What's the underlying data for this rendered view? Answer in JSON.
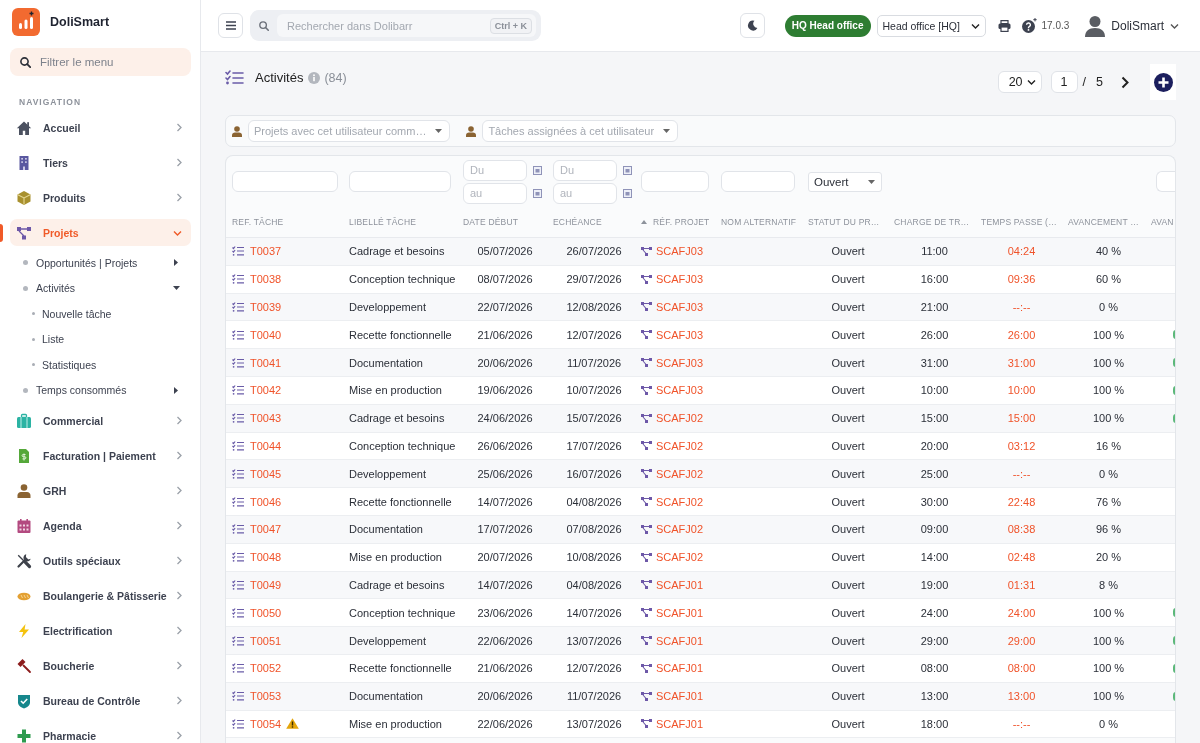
{
  "app": {
    "name": "DoliSmart"
  },
  "sidebar": {
    "filter": {
      "placeholder": "Filtrer le menu"
    },
    "section_title": "NAVIGATION",
    "items": [
      {
        "label": "Accueil",
        "selected": false,
        "expanded": false
      },
      {
        "label": "Tiers",
        "selected": false,
        "expanded": false
      },
      {
        "label": "Produits",
        "selected": false,
        "expanded": false
      },
      {
        "label": "Projets",
        "selected": true,
        "expanded": true,
        "children": [
          {
            "label": "Opportunités | Projets",
            "expanded": false
          },
          {
            "label": "Activités",
            "expanded": true,
            "children": [
              {
                "label": "Nouvelle tâche"
              },
              {
                "label": "Liste"
              },
              {
                "label": "Statistiques"
              }
            ]
          },
          {
            "label": "Temps consommés",
            "expanded": false
          }
        ]
      },
      {
        "label": "Commercial",
        "selected": false,
        "expanded": false
      },
      {
        "label": "Facturation | Paiement",
        "selected": false,
        "expanded": false
      },
      {
        "label": "GRH",
        "selected": false,
        "expanded": false
      },
      {
        "label": "Agenda",
        "selected": false,
        "expanded": false
      },
      {
        "label": "Outils spéciaux",
        "selected": false,
        "expanded": false
      },
      {
        "label": "Boulangerie & Pâtisserie",
        "selected": false,
        "expanded": false
      },
      {
        "label": "Electrification",
        "selected": false,
        "expanded": false
      },
      {
        "label": "Boucherie",
        "selected": false,
        "expanded": false
      },
      {
        "label": "Bureau de Contrôle",
        "selected": false,
        "expanded": false
      },
      {
        "label": "Pharmacie",
        "selected": false,
        "expanded": false
      }
    ]
  },
  "topbar": {
    "search": {
      "placeholder": "Rechercher dans Dolibarr",
      "shortcut": "Ctrl + K"
    },
    "entity_badge": "HQ Head office",
    "entity_select": "Head office [HQ]",
    "version": "17.0.3",
    "user": "DoliSmart"
  },
  "page": {
    "title": "Activités",
    "count": "(84)",
    "pagination": {
      "per_page": "20",
      "page": "1",
      "separator": "/",
      "total": "5"
    }
  },
  "filters": [
    {
      "placeholder": "Projets avec cet utilisateur comm…"
    },
    {
      "placeholder": "Tâches assignées à cet utilisateur"
    }
  ],
  "table": {
    "columns": [
      {
        "label": "REF. TÂCHE",
        "sorted": false,
        "filter": {
          "kind": "text"
        }
      },
      {
        "label": "LIBELLÉ TÂCHE",
        "sorted": false,
        "filter": {
          "kind": "text"
        }
      },
      {
        "label": "DATE DÉBUT",
        "sorted": false,
        "filter": {
          "kind": "date-range",
          "from": {
            "placeholder": "Du"
          },
          "to": {
            "placeholder": "au"
          }
        }
      },
      {
        "label": "ECHÉANCE",
        "sorted": false,
        "filter": {
          "kind": "date-range",
          "from": {
            "placeholder": "Du"
          },
          "to": {
            "placeholder": "au"
          }
        }
      },
      {
        "label": "RÉF. PROJET",
        "sorted": true,
        "filter": {
          "kind": "text"
        }
      },
      {
        "label": "NOM ALTERNATIF",
        "sorted": false,
        "filter": {
          "kind": "text"
        }
      },
      {
        "label": "STATUT DU PR…",
        "sorted": false,
        "filter": {
          "kind": "select",
          "value": "Ouvert"
        }
      },
      {
        "label": "CHARGE DE TR…",
        "sorted": false
      },
      {
        "label": "TEMPS PASSE (…",
        "sorted": false
      },
      {
        "label": "AVANCEMENT …",
        "sorted": false
      },
      {
        "label": "AVAN",
        "sorted": false,
        "filter": {
          "kind": "text"
        }
      }
    ],
    "rows": [
      {
        "ref": "T0037",
        "warning": false,
        "label": "Cadrage et besoins",
        "start": "05/07/2026",
        "due": "26/07/2026",
        "project": "SCAFJ03",
        "status": "Ouvert",
        "planned": "11:00",
        "spent": "04:24",
        "progress": "40 %",
        "complete": false
      },
      {
        "ref": "T0038",
        "warning": false,
        "label": "Conception technique",
        "start": "08/07/2026",
        "due": "29/07/2026",
        "project": "SCAFJ03",
        "status": "Ouvert",
        "planned": "16:00",
        "spent": "09:36",
        "progress": "60 %",
        "complete": false
      },
      {
        "ref": "T0039",
        "warning": false,
        "label": "Developpement",
        "start": "22/07/2026",
        "due": "12/08/2026",
        "project": "SCAFJ03",
        "status": "Ouvert",
        "planned": "21:00",
        "spent": "--:--",
        "progress": "0 %",
        "complete": false
      },
      {
        "ref": "T0040",
        "warning": false,
        "label": "Recette fonctionnelle",
        "start": "21/06/2026",
        "due": "12/07/2026",
        "project": "SCAFJ03",
        "status": "Ouvert",
        "planned": "26:00",
        "spent": "26:00",
        "progress": "100 %",
        "complete": true
      },
      {
        "ref": "T0041",
        "warning": false,
        "label": "Documentation",
        "start": "20/06/2026",
        "due": "11/07/2026",
        "project": "SCAFJ03",
        "status": "Ouvert",
        "planned": "31:00",
        "spent": "31:00",
        "progress": "100 %",
        "complete": true
      },
      {
        "ref": "T0042",
        "warning": false,
        "label": "Mise en production",
        "start": "19/06/2026",
        "due": "10/07/2026",
        "project": "SCAFJ03",
        "status": "Ouvert",
        "planned": "10:00",
        "spent": "10:00",
        "progress": "100 %",
        "complete": true
      },
      {
        "ref": "T0043",
        "warning": false,
        "label": "Cadrage et besoins",
        "start": "24/06/2026",
        "due": "15/07/2026",
        "project": "SCAFJ02",
        "status": "Ouvert",
        "planned": "15:00",
        "spent": "15:00",
        "progress": "100 %",
        "complete": true
      },
      {
        "ref": "T0044",
        "warning": false,
        "label": "Conception technique",
        "start": "26/06/2026",
        "due": "17/07/2026",
        "project": "SCAFJ02",
        "status": "Ouvert",
        "planned": "20:00",
        "spent": "03:12",
        "progress": "16 %",
        "complete": false
      },
      {
        "ref": "T0045",
        "warning": false,
        "label": "Developpement",
        "start": "25/06/2026",
        "due": "16/07/2026",
        "project": "SCAFJ02",
        "status": "Ouvert",
        "planned": "25:00",
        "spent": "--:--",
        "progress": "0 %",
        "complete": false
      },
      {
        "ref": "T0046",
        "warning": false,
        "label": "Recette fonctionnelle",
        "start": "14/07/2026",
        "due": "04/08/2026",
        "project": "SCAFJ02",
        "status": "Ouvert",
        "planned": "30:00",
        "spent": "22:48",
        "progress": "76 %",
        "complete": false
      },
      {
        "ref": "T0047",
        "warning": false,
        "label": "Documentation",
        "start": "17/07/2026",
        "due": "07/08/2026",
        "project": "SCAFJ02",
        "status": "Ouvert",
        "planned": "09:00",
        "spent": "08:38",
        "progress": "96 %",
        "complete": false
      },
      {
        "ref": "T0048",
        "warning": false,
        "label": "Mise en production",
        "start": "20/07/2026",
        "due": "10/08/2026",
        "project": "SCAFJ02",
        "status": "Ouvert",
        "planned": "14:00",
        "spent": "02:48",
        "progress": "20 %",
        "complete": false
      },
      {
        "ref": "T0049",
        "warning": false,
        "label": "Cadrage et besoins",
        "start": "14/07/2026",
        "due": "04/08/2026",
        "project": "SCAFJ01",
        "status": "Ouvert",
        "planned": "19:00",
        "spent": "01:31",
        "progress": "8 %",
        "complete": false
      },
      {
        "ref": "T0050",
        "warning": false,
        "label": "Conception technique",
        "start": "23/06/2026",
        "due": "14/07/2026",
        "project": "SCAFJ01",
        "status": "Ouvert",
        "planned": "24:00",
        "spent": "24:00",
        "progress": "100 %",
        "complete": true
      },
      {
        "ref": "T0051",
        "warning": false,
        "label": "Developpement",
        "start": "22/06/2026",
        "due": "13/07/2026",
        "project": "SCAFJ01",
        "status": "Ouvert",
        "planned": "29:00",
        "spent": "29:00",
        "progress": "100 %",
        "complete": true
      },
      {
        "ref": "T0052",
        "warning": false,
        "label": "Recette fonctionnelle",
        "start": "21/06/2026",
        "due": "12/07/2026",
        "project": "SCAFJ01",
        "status": "Ouvert",
        "planned": "08:00",
        "spent": "08:00",
        "progress": "100 %",
        "complete": true
      },
      {
        "ref": "T0053",
        "warning": false,
        "label": "Documentation",
        "start": "20/06/2026",
        "due": "11/07/2026",
        "project": "SCAFJ01",
        "status": "Ouvert",
        "planned": "13:00",
        "spent": "13:00",
        "progress": "100 %",
        "complete": true
      },
      {
        "ref": "T0054",
        "warning": true,
        "label": "Mise en production",
        "start": "22/06/2026",
        "due": "13/07/2026",
        "project": "SCAFJ01",
        "status": "Ouvert",
        "planned": "18:00",
        "spent": "--:--",
        "progress": "0 %",
        "complete": false
      }
    ]
  }
}
